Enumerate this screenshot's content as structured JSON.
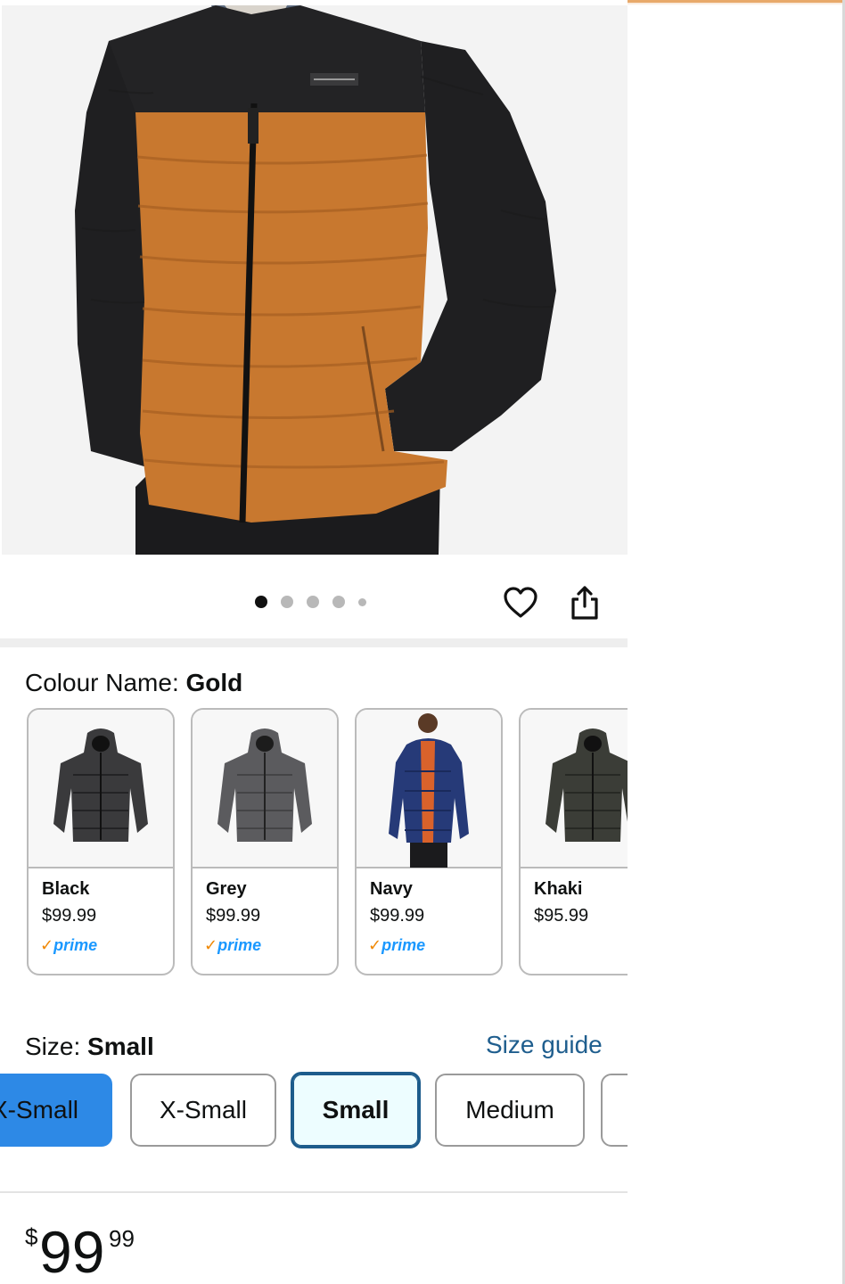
{
  "gallery": {
    "dots_count": 5,
    "active_dot": 1
  },
  "product": {
    "colour_label": "Colour Name:",
    "colour_value": "Gold",
    "swatches": [
      {
        "name": "Black",
        "price": "$99.99",
        "prime": "prime",
        "color": "#3a3a3c"
      },
      {
        "name": "Grey",
        "price": "$99.99",
        "prime": "prime",
        "color": "#5b5b5e"
      },
      {
        "name": "Navy",
        "price": "$99.99",
        "prime": "prime",
        "color": "#263a78"
      },
      {
        "name": "Khaki",
        "price": "$95.99",
        "prime": "",
        "color": "#3b3d37"
      }
    ],
    "size_label": "Size:",
    "size_value": "Small",
    "size_guide": "Size guide",
    "sizes": [
      "X-Small",
      "X-Small",
      "Small",
      "Medium",
      ""
    ],
    "price": {
      "symbol": "$",
      "whole": "99",
      "fraction": "99"
    }
  },
  "colors": {
    "jacket_gold": "#c8782f",
    "jacket_black": "#1f1f21",
    "link_blue": "#1f5e8e",
    "selected_blue": "#1d5c8c",
    "prime_blue": "#1a98ff"
  }
}
